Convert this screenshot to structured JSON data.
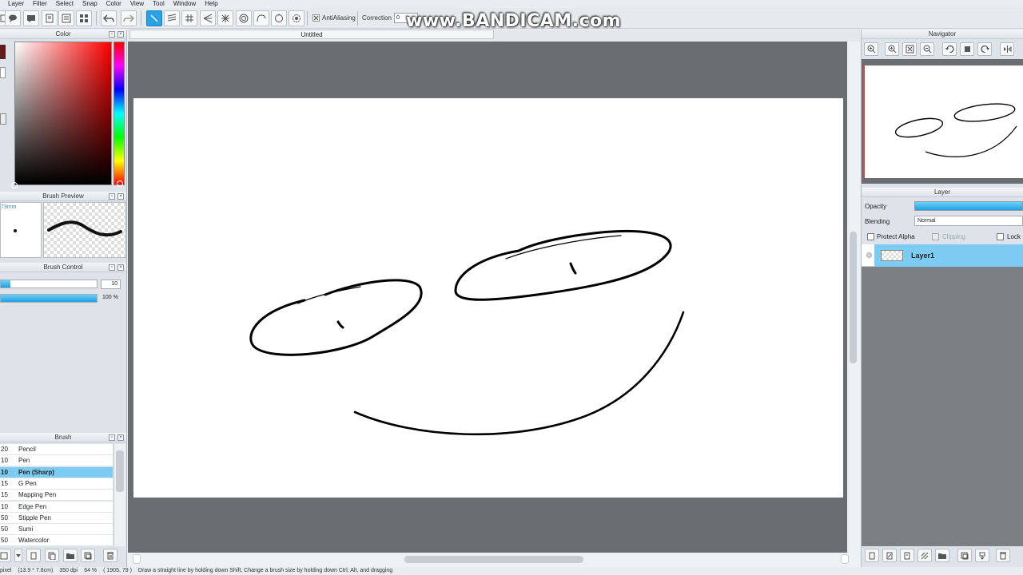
{
  "menu": [
    "Layer",
    "Filter",
    "Select",
    "Snap",
    "Color",
    "View",
    "Tool",
    "Window",
    "Help"
  ],
  "toolbar": {
    "antialiasing_label": "AntiAliasing",
    "correction_label": "Correction",
    "correction_value": "0",
    "watermark": "www.BANDICAM.com"
  },
  "color_panel": {
    "title": "Color"
  },
  "brush_preview": {
    "title": "Brush Preview",
    "size_text": "73mm"
  },
  "brush_control": {
    "title": "Brush Control",
    "size_value": "10",
    "density_value": "100 %",
    "density_fraction": 1.0,
    "size_fraction": 0.1
  },
  "brush_panel": {
    "title": "Brush",
    "items": [
      {
        "size": "20",
        "name": "Pencil"
      },
      {
        "size": "10",
        "name": "Pen"
      },
      {
        "size": "10",
        "name": "Pen (Sharp)"
      },
      {
        "size": "15",
        "name": "G Pen"
      },
      {
        "size": "15",
        "name": "Mapping Pen"
      },
      {
        "size": "10",
        "name": "Edge Pen"
      },
      {
        "size": "50",
        "name": "Stipple Pen"
      },
      {
        "size": "50",
        "name": "Sumi"
      },
      {
        "size": "50",
        "name": "Watercolor"
      }
    ],
    "selected_index": 2
  },
  "document": {
    "tab_title": "Untitled"
  },
  "navigator": {
    "title": "Navigator"
  },
  "layer_panel": {
    "title": "Layer",
    "opacity_label": "Opacity",
    "blending_label": "Blending",
    "blending_value": "Normal",
    "protect_alpha_label": "Protect Alpha",
    "clipping_label": "Clipping",
    "lock_label": "Lock",
    "layers": [
      {
        "name": "Layer1"
      }
    ]
  },
  "statusbar": {
    "unit": "pixel",
    "dimensions": "(13.9 * 7.8cm)",
    "dpi": "350 dpi",
    "zoom": "64 %",
    "coords": "( 1905, 79 )",
    "hint": "Draw a straight line by holding down Shift, Change a brush size by holding down Ctrl, Alt, and dragging"
  },
  "colors": {
    "accent": "#29a3e6",
    "selection": "#7ccbf2",
    "workspace": "#6a6e73"
  }
}
